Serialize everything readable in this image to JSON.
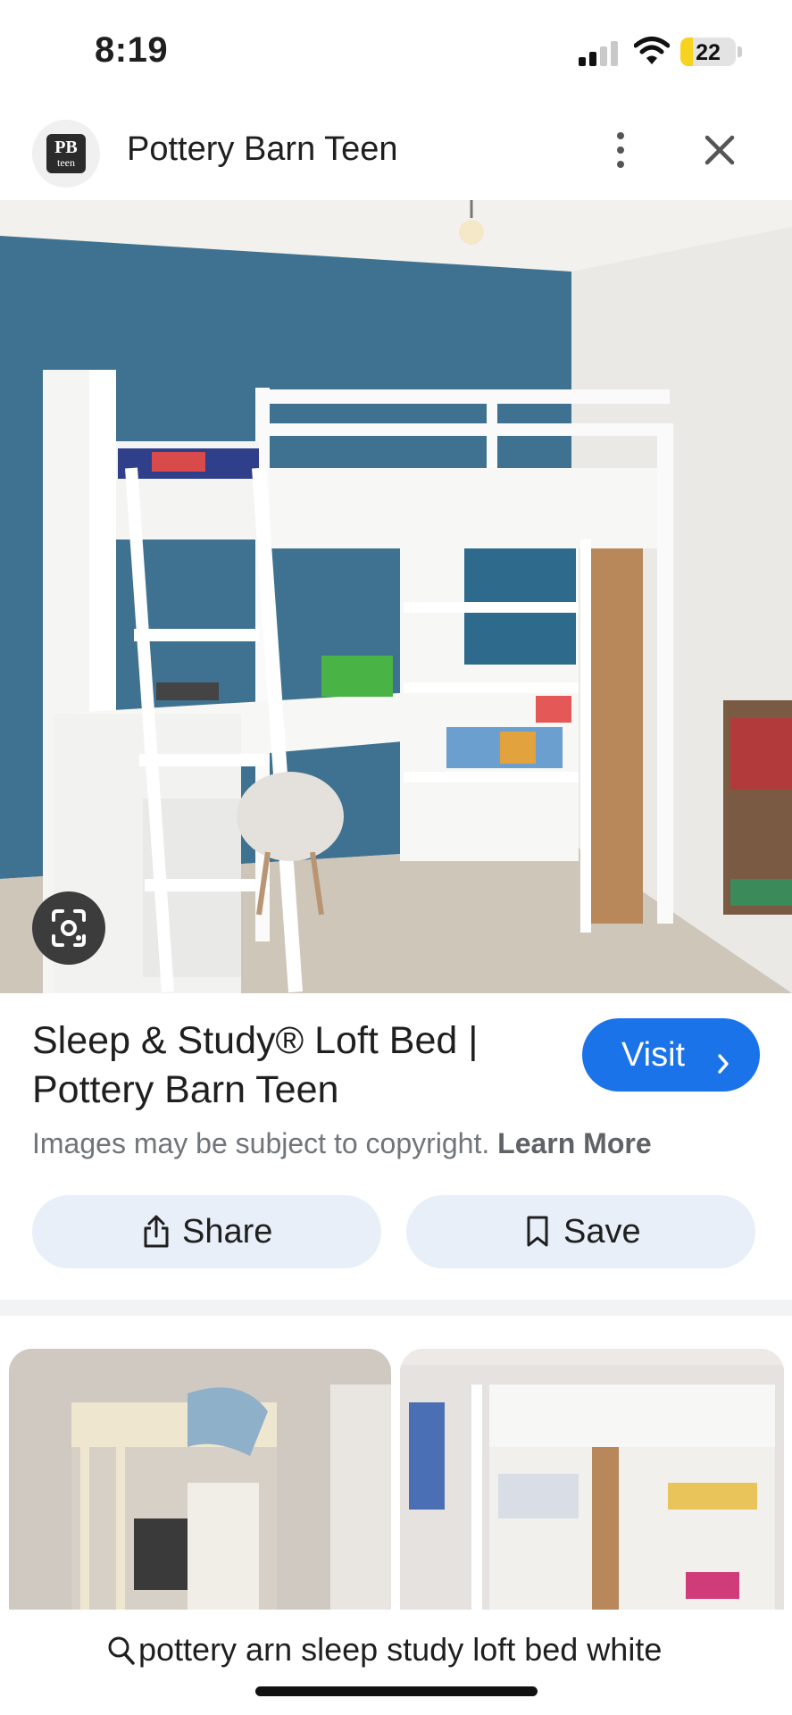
{
  "status_bar": {
    "time": "8:19",
    "battery_level": "22",
    "battery_fraction": 0.22,
    "signal_bars_active": 2,
    "signal_bars_total": 4,
    "icons": [
      "cellular-signal-icon",
      "wifi-icon",
      "battery-icon"
    ]
  },
  "header": {
    "site_name": "Pottery Barn Teen",
    "logo_top": "PB",
    "logo_bottom": "teen",
    "icons": [
      "more-vert-icon",
      "close-icon"
    ]
  },
  "result": {
    "title": "Sleep & Study® Loft Bed | Pottery Barn Teen",
    "visit_label": "Visit",
    "copyright_text": "Images may be subject to copyright.",
    "learn_more": "Learn More",
    "lens_icon": "google-lens-icon"
  },
  "actions": {
    "share_label": "Share",
    "save_label": "Save",
    "share_icon": "share-icon",
    "save_icon": "bookmark-icon"
  },
  "search": {
    "query": "pottery arn sleep study loft bed white",
    "icon": "search-icon"
  },
  "colors": {
    "accent": "#1a73e8",
    "chip_bg": "#e8eff9",
    "battery": "#f7d21e",
    "wall_blue": "#3f7291"
  }
}
